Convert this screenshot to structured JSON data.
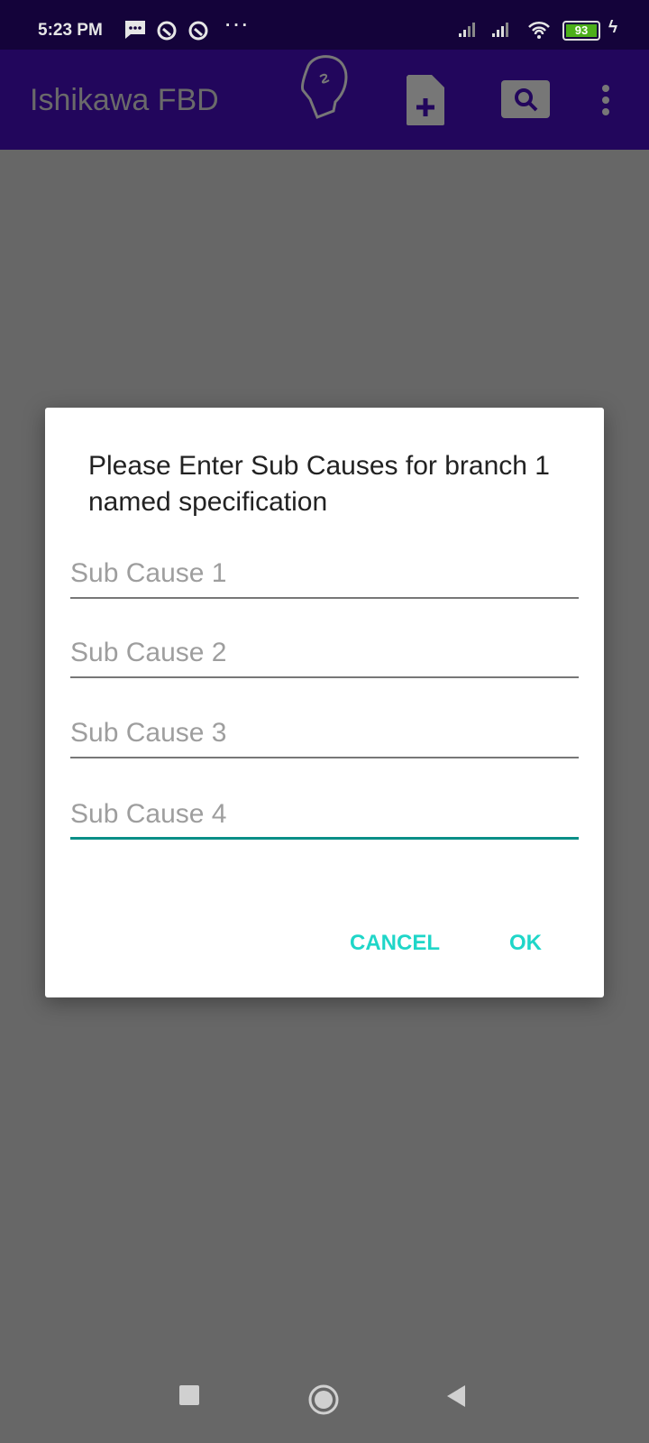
{
  "status_bar": {
    "time": "5:23 PM",
    "battery": "93",
    "icons": [
      "message-icon",
      "app-notification-icon",
      "app-notification-icon",
      "more-dots-icon",
      "signal-icon",
      "signal-icon",
      "wifi-icon",
      "battery-icon",
      "charging-icon"
    ]
  },
  "app_bar": {
    "title": "Ishikawa FBD",
    "actions": [
      "head-icon",
      "new-file-icon",
      "search-icon",
      "overflow-menu-icon"
    ]
  },
  "dialog": {
    "title": "Please Enter Sub Causes for branch 1 named specification",
    "fields": [
      {
        "placeholder": "Sub Cause 1",
        "value": ""
      },
      {
        "placeholder": "Sub Cause 2",
        "value": ""
      },
      {
        "placeholder": "Sub Cause 3",
        "value": ""
      },
      {
        "placeholder": "Sub Cause 4",
        "value": "",
        "focused": true
      }
    ],
    "cancel_label": "CANCEL",
    "ok_label": "OK"
  },
  "colors": {
    "accent": "#1fd6c8",
    "focus_line": "#0a8f87",
    "app_bar": "#22065c",
    "status_bar": "#14033a"
  }
}
